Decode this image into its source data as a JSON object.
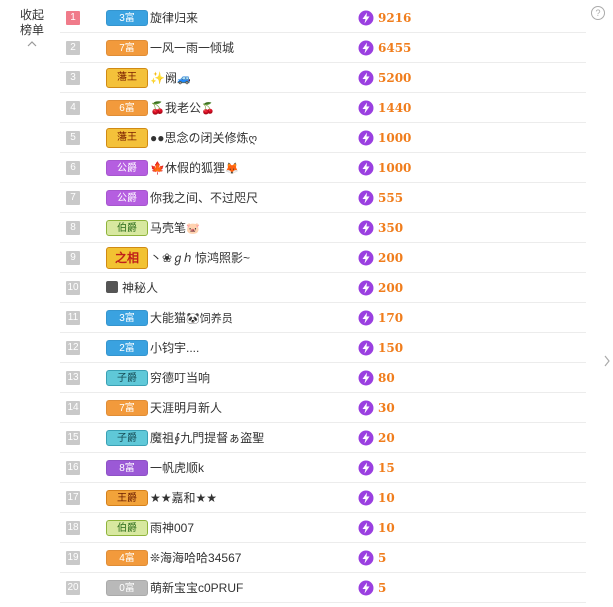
{
  "sidebar": {
    "collapse_label_1": "收起",
    "collapse_label_2": "榜单"
  },
  "help_icon": "?",
  "rows": [
    {
      "rank": "1",
      "badge": "3富",
      "badge_style": "fu-blue",
      "name": "旋律归来",
      "emoji": "",
      "score": "9216"
    },
    {
      "rank": "2",
      "badge": "7富",
      "badge_style": "fu-orange",
      "name": "一风一雨一倾城",
      "emoji": "",
      "score": "6455"
    },
    {
      "rank": "3",
      "badge": "藩王",
      "badge_style": "fan",
      "name": "✨阙",
      "emoji": "🚙",
      "score": "5200"
    },
    {
      "rank": "4",
      "badge": "6富",
      "badge_style": "fu-orange",
      "name": "🍒我老公",
      "emoji": "🍒",
      "score": "1440"
    },
    {
      "rank": "5",
      "badge": "藩王",
      "badge_style": "fan",
      "name": "●●思念の闭关修炼",
      "emoji": "ღ",
      "score": "1000"
    },
    {
      "rank": "6",
      "badge": "公爵",
      "badge_style": "gong",
      "name": "🍁休假的狐狸",
      "emoji": "🦊",
      "score": "1000"
    },
    {
      "rank": "7",
      "badge": "公爵",
      "badge_style": "gong",
      "name": "你我之间、不过咫尺",
      "emoji": "",
      "score": "555"
    },
    {
      "rank": "8",
      "badge": "伯爵",
      "badge_style": "bo",
      "name": "马壳笔",
      "emoji": "🐷",
      "score": "350"
    },
    {
      "rank": "9",
      "badge": "之相",
      "badge_style": "zhi",
      "name": "丶❀ℊℎ 惊鸿照影~",
      "emoji": "",
      "score": "200"
    },
    {
      "rank": "10",
      "badge": "",
      "badge_style": "",
      "name": "神秘人",
      "emoji": "",
      "score": "200",
      "mystery": true
    },
    {
      "rank": "11",
      "badge": "3富",
      "badge_style": "fu-blue",
      "name": "大能猫",
      "emoji": "🐼饲养员",
      "score": "170"
    },
    {
      "rank": "12",
      "badge": "2富",
      "badge_style": "fu-blue",
      "name": "小钧宇....",
      "emoji": "",
      "score": "150"
    },
    {
      "rank": "13",
      "badge": "子爵",
      "badge_style": "zi",
      "name": "穷德叮当响",
      "emoji": "",
      "score": "80"
    },
    {
      "rank": "14",
      "badge": "7富",
      "badge_style": "fu-orange",
      "name": "天涯明月新人",
      "emoji": "",
      "score": "30"
    },
    {
      "rank": "15",
      "badge": "子爵",
      "badge_style": "zi",
      "name": "魔祖∮九門提督ぁ盗聖",
      "emoji": "",
      "score": "20"
    },
    {
      "rank": "16",
      "badge": "8富",
      "badge_style": "fu-purple",
      "name": "一帆虎顺k",
      "emoji": "",
      "score": "15"
    },
    {
      "rank": "17",
      "badge": "王爵",
      "badge_style": "wang",
      "name": "★★嘉和★★",
      "emoji": "",
      "score": "10"
    },
    {
      "rank": "18",
      "badge": "伯爵",
      "badge_style": "bo",
      "name": "雨神007",
      "emoji": "",
      "score": "10"
    },
    {
      "rank": "19",
      "badge": "4富",
      "badge_style": "fu-orange",
      "name": "❊海海哈哈34567",
      "emoji": "",
      "score": "5"
    },
    {
      "rank": "20",
      "badge": "0富",
      "badge_style": "fu-gray",
      "name": "萌新宝宝c0PRUF",
      "emoji": "",
      "score": "5"
    }
  ],
  "colors": {
    "score": "#f07d1c",
    "first_rank": "#f07b8a",
    "rank": "#c9c9c9"
  },
  "icons": {
    "score": "purple-lightning-icon",
    "collapse": "chevron-up-icon",
    "side": "chevron-right-icon"
  }
}
